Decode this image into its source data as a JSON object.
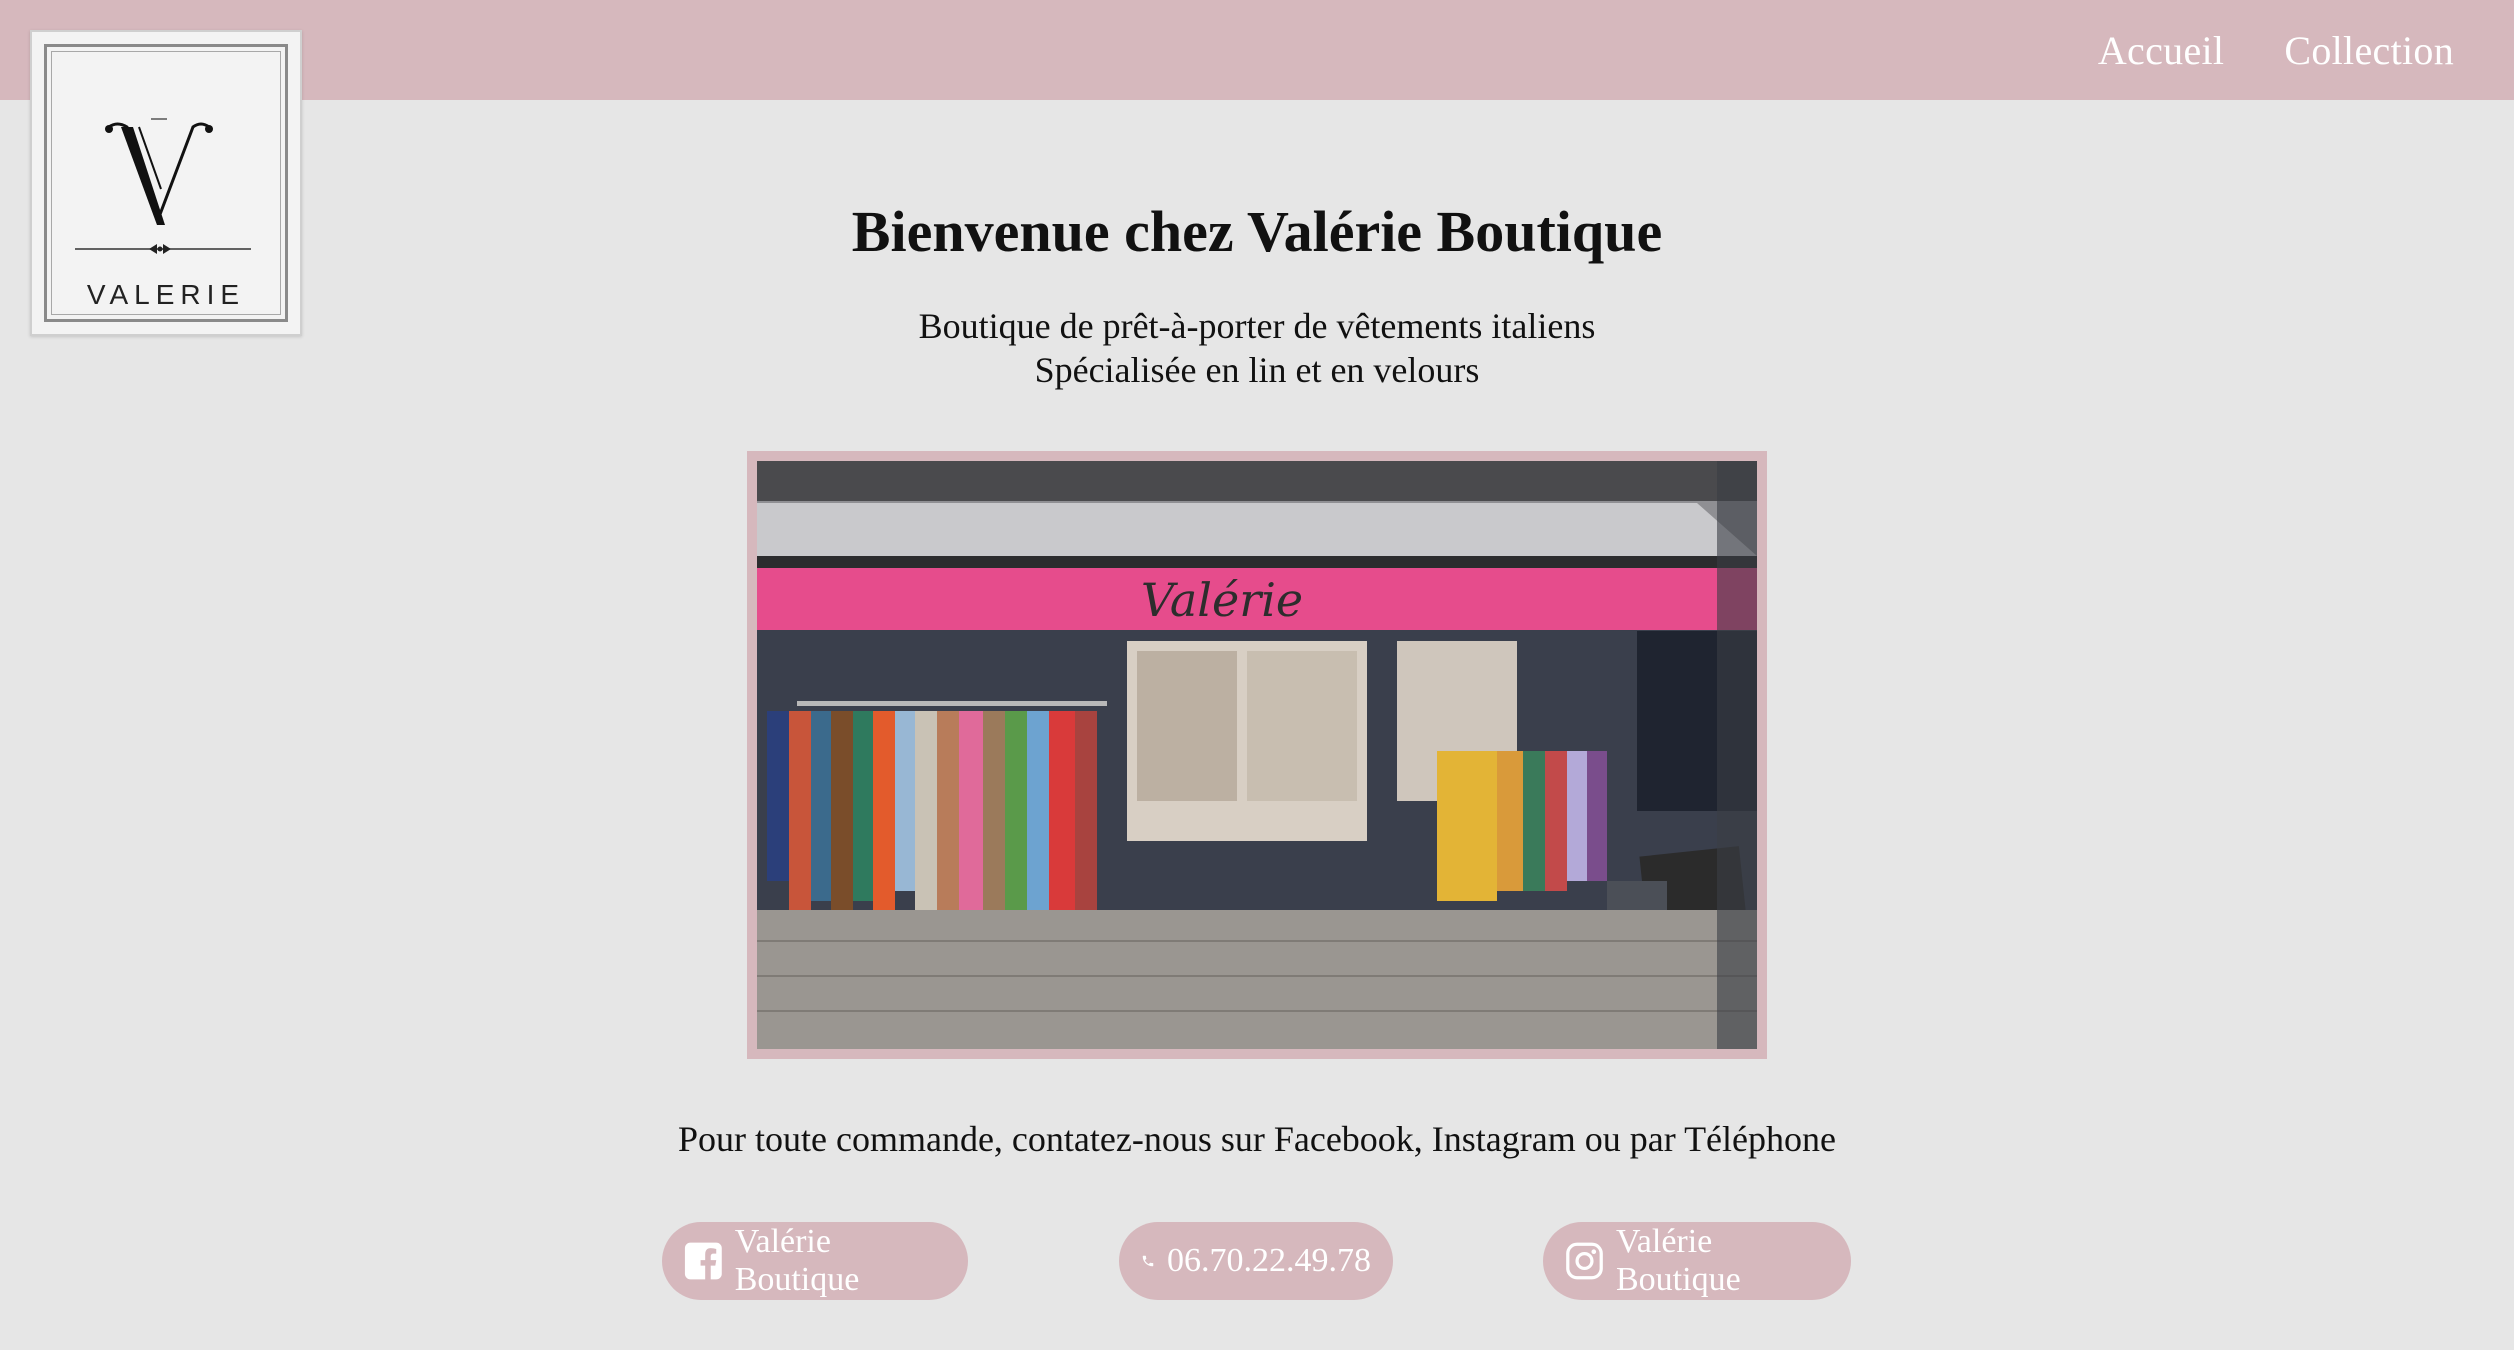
{
  "nav": {
    "items": [
      {
        "label": "Accueil"
      },
      {
        "label": "Collection"
      }
    ]
  },
  "logo": {
    "text": "VALERIE"
  },
  "hero": {
    "title": "Bienvenue chez Valérie Boutique",
    "subtitle_line1": "Boutique de prêt-à-porter de vêtements italiens",
    "subtitle_line2": "Spécialisée en lin et en velours"
  },
  "storefront": {
    "awning_text": "Valérie"
  },
  "contact": {
    "line": "Pour toute commande, contatez-nous sur Facebook, Instagram ou par Téléphone",
    "facebook_label": "Valérie Boutique",
    "phone_label": "06.70.22.49.78",
    "instagram_label": "Valérie Boutique"
  },
  "colors": {
    "accent": "#d6b8bd",
    "background": "#e6e6e6",
    "awning": "#e64c8c"
  }
}
